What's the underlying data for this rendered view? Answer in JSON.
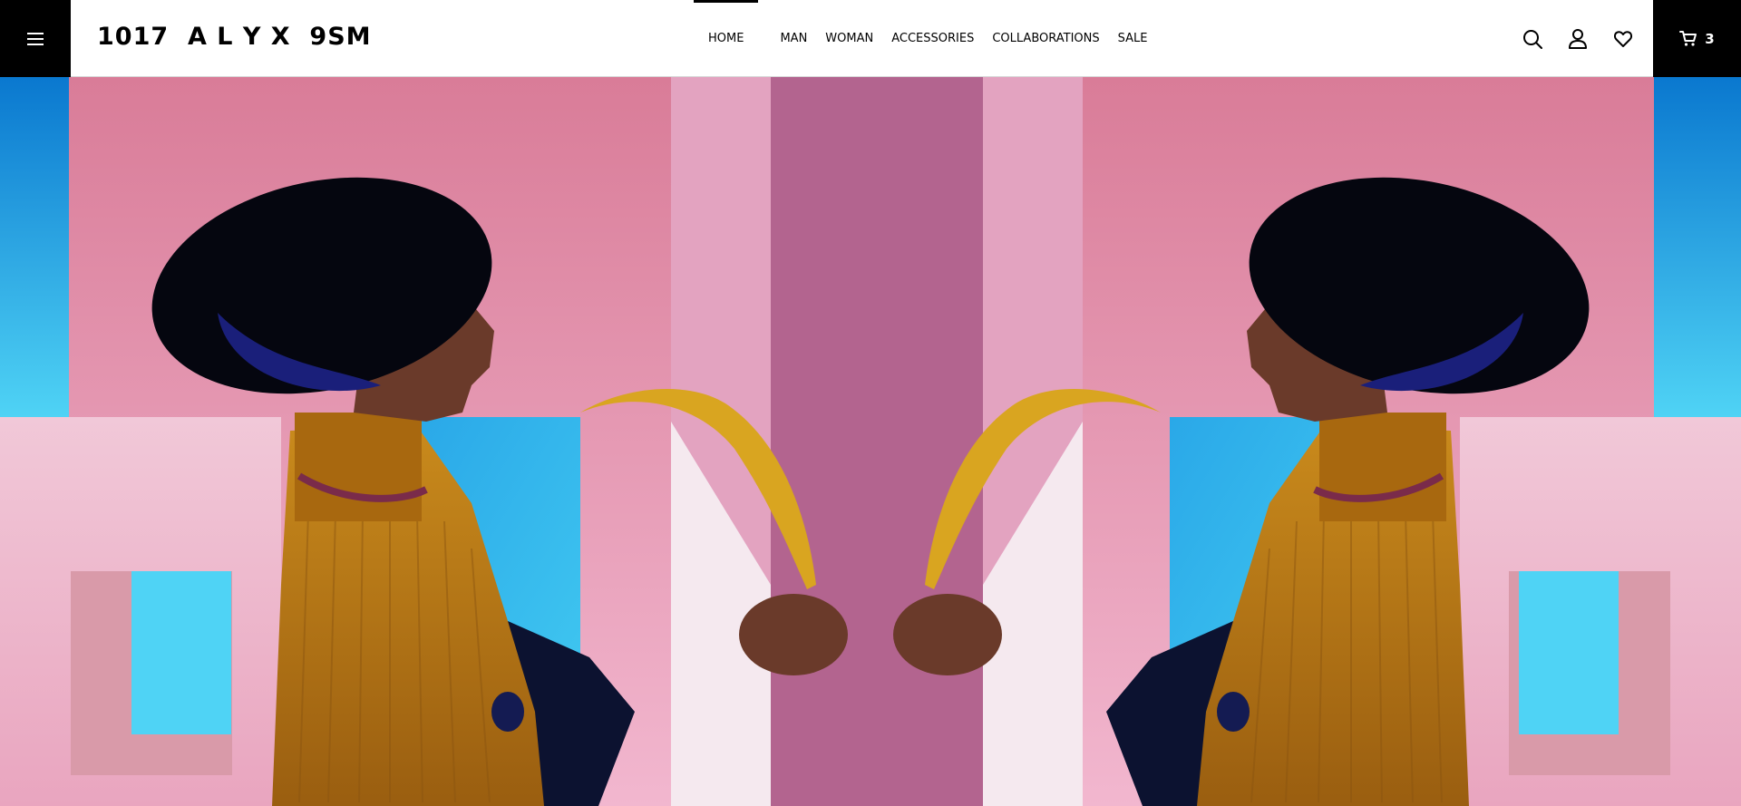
{
  "brand": {
    "logo_text": "1017  A L Y X  9SM"
  },
  "nav": {
    "items": [
      {
        "label": "HOME",
        "active": true
      },
      {
        "label": "MAN",
        "active": false
      },
      {
        "label": "WOMAN",
        "active": false
      },
      {
        "label": "ACCESSORIES",
        "active": false
      },
      {
        "label": "COLLABORATIONS",
        "active": false
      },
      {
        "label": "SALE",
        "active": false
      }
    ]
  },
  "header_icons": [
    "menu-icon",
    "search-icon",
    "user-icon",
    "heart-icon",
    "cart-icon"
  ],
  "cart": {
    "count": "3"
  },
  "colors": {
    "header_bg": "#ffffff",
    "dark": "#000000",
    "hero_pink": "#e07fa0",
    "hero_blue": "#2aa8e8",
    "sweater_orange": "#c98a1c",
    "feather_gold": "#d9a520",
    "hat_navy": "#0a0d2a"
  },
  "hero": {
    "description_icon": "hero-image"
  }
}
